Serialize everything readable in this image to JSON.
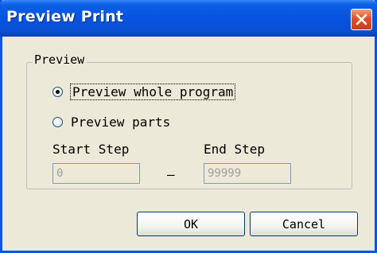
{
  "window": {
    "title": "Preview Print"
  },
  "group": {
    "legend": "Preview"
  },
  "options": {
    "whole_program": "Preview whole program",
    "parts": "Preview parts",
    "selected": "whole_program"
  },
  "fields": {
    "start_step_label": "Start Step",
    "start_step_value": "0",
    "separator": "–",
    "end_step_label": "End Step",
    "end_step_value": "99999"
  },
  "buttons": {
    "ok": "OK",
    "cancel": "Cancel"
  },
  "icons": {
    "close": "close-icon"
  },
  "colors": {
    "titlebar": "#0554e0",
    "close_button": "#e0502a",
    "dialog_bg": "#ece9d8",
    "radio_selected_dot": "#000000"
  }
}
